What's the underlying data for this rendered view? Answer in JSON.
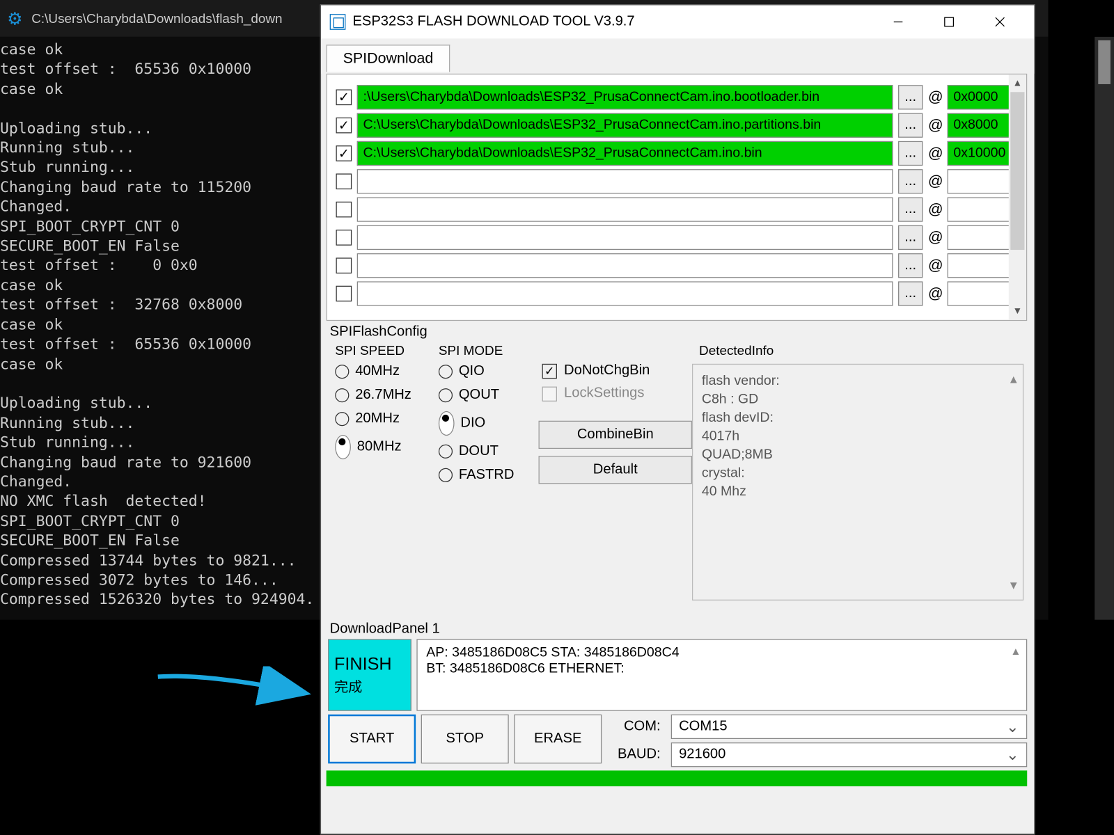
{
  "terminal": {
    "title": "C:\\Users\\Charybda\\Downloads\\flash_down",
    "text": "case ok\ntest offset :  65536 0x10000\ncase ok\n\nUploading stub...\nRunning stub...\nStub running...\nChanging baud rate to 115200\nChanged.\nSPI_BOOT_CRYPT_CNT 0\nSECURE_BOOT_EN False\ntest offset :    0 0x0\ncase ok\ntest offset :  32768 0x8000\ncase ok\ntest offset :  65536 0x10000\ncase ok\n\nUploading stub...\nRunning stub...\nStub running...\nChanging baud rate to 921600\nChanged.\nNO XMC flash  detected!\nSPI_BOOT_CRYPT_CNT 0\nSECURE_BOOT_EN False\nCompressed 13744 bytes to 9821...\nCompressed 3072 bytes to 146...\nCompressed 1526320 bytes to 924904."
  },
  "win": {
    "title": "ESP32S3 FLASH DOWNLOAD TOOL V3.9.7",
    "tab": "SPIDownload",
    "files": [
      {
        "checked": true,
        "path": ":\\Users\\Charybda\\Downloads\\ESP32_PrusaConnectCam.ino.bootloader.bin",
        "addr": "0x0000",
        "green": true
      },
      {
        "checked": true,
        "path": "C:\\Users\\Charybda\\Downloads\\ESP32_PrusaConnectCam.ino.partitions.bin",
        "addr": "0x8000",
        "green": true
      },
      {
        "checked": true,
        "path": "C:\\Users\\Charybda\\Downloads\\ESP32_PrusaConnectCam.ino.bin",
        "addr": "0x10000",
        "green": true
      },
      {
        "checked": false,
        "path": "",
        "addr": "",
        "green": false
      },
      {
        "checked": false,
        "path": "",
        "addr": "",
        "green": false
      },
      {
        "checked": false,
        "path": "",
        "addr": "",
        "green": false
      },
      {
        "checked": false,
        "path": "",
        "addr": "",
        "green": false
      },
      {
        "checked": false,
        "path": "",
        "addr": "",
        "green": false
      }
    ],
    "cfg_label": "SPIFlashConfig",
    "spi_speed": {
      "label": "SPI SPEED",
      "options": [
        "40MHz",
        "26.7MHz",
        "20MHz",
        "80MHz"
      ],
      "selected": "80MHz"
    },
    "spi_mode": {
      "label": "SPI MODE",
      "options": [
        "QIO",
        "QOUT",
        "DIO",
        "DOUT",
        "FASTRD"
      ],
      "selected": "DIO"
    },
    "donotchg": {
      "label": "DoNotChgBin",
      "checked": true
    },
    "locksettings": {
      "label": "LockSettings",
      "checked": false
    },
    "btn_combine": "CombineBin",
    "btn_default": "Default",
    "detected_label": "DetectedInfo",
    "detected_text": "flash vendor:\nC8h : GD\nflash devID:\n4017h\nQUAD;8MB\ncrystal:\n40 Mhz",
    "dl_label": "DownloadPanel 1",
    "finish": {
      "line1": "FINISH",
      "line2": "完成"
    },
    "info": "AP: 3485186D08C5 STA: 3485186D08C4\nBT: 3485186D08C6 ETHERNET:",
    "btn_start": "START",
    "btn_stop": "STOP",
    "btn_erase": "ERASE",
    "com_label": "COM:",
    "com_value": "COM15",
    "baud_label": "BAUD:",
    "baud_value": "921600"
  }
}
